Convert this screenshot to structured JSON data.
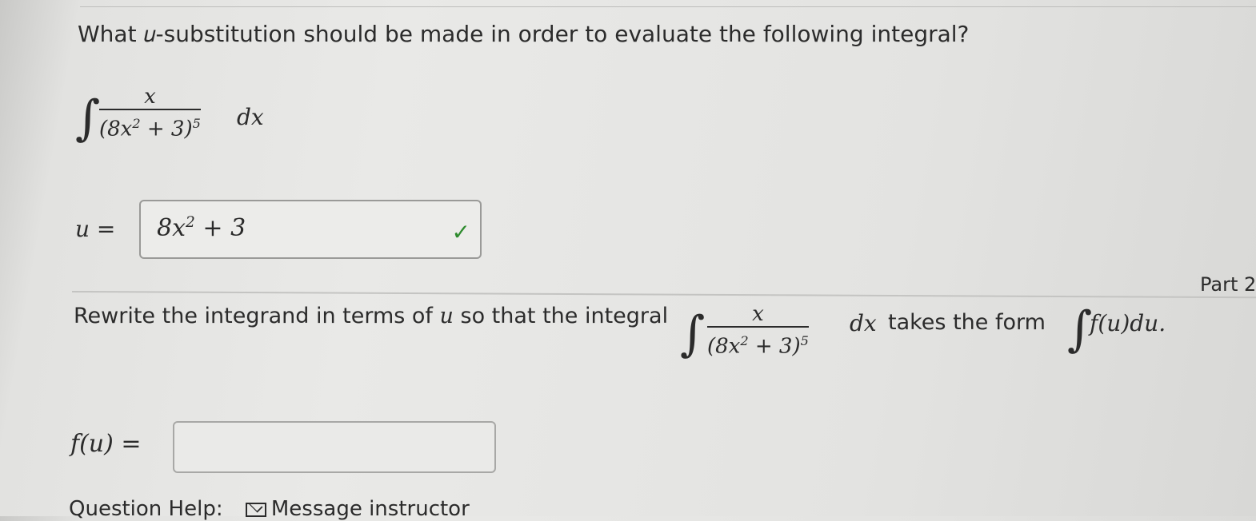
{
  "part1": {
    "question": "What 𝑢-substitution should be made in order to evaluate the following integral?",
    "integral": {
      "numerator": "𝑥",
      "denominator_base": "(8𝑥",
      "denominator_sq": "2",
      "denominator_rest": " + 3)",
      "denominator_pow": "5",
      "differential": "𝑑𝑥"
    },
    "u_label": "𝑢 =",
    "answer_main": "8𝑥",
    "answer_sup": "2",
    "answer_rest": " + 3",
    "answer_status": "correct"
  },
  "part_label": "Part 2",
  "part2": {
    "text_before": "Rewrite the integrand in terms of ",
    "var": "𝑢",
    "text_middle": " so that the integral",
    "text_after": "takes the form",
    "form": "𝑓(𝑢)𝑑𝑢.",
    "fu_label": "𝑓(𝑢) =",
    "fu_value": ""
  },
  "help": {
    "label": "Question Help:",
    "link": "Message instructor"
  }
}
